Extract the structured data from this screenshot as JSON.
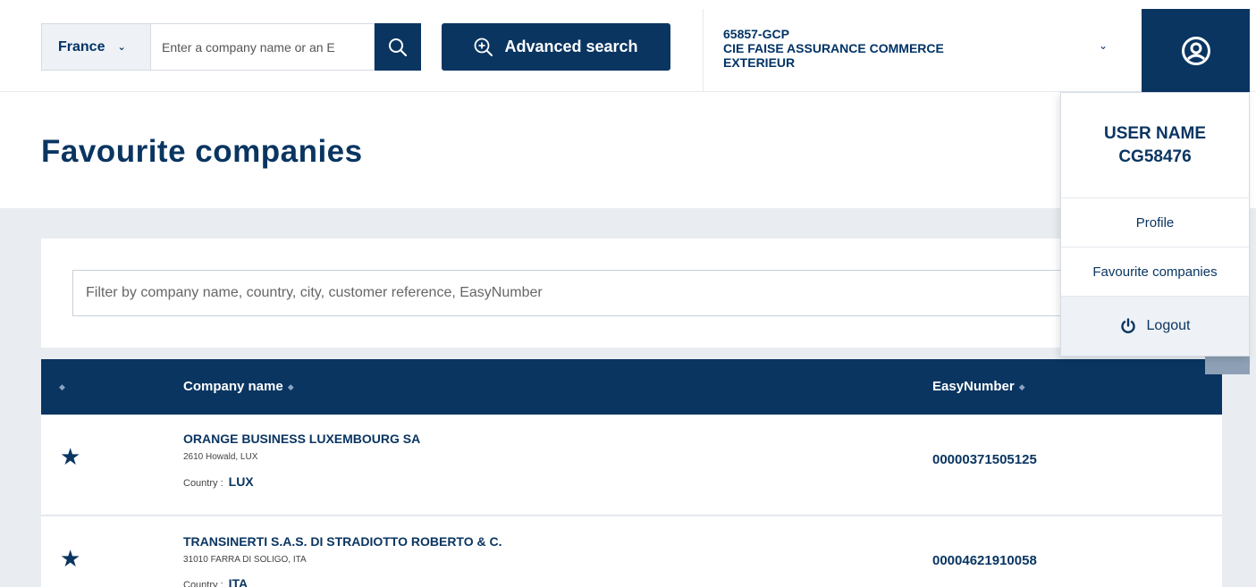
{
  "header": {
    "country": "France",
    "search_placeholder": "Enter a company name or an E",
    "advanced_search_label": "Advanced search",
    "account_line1": "65857-GCP",
    "account_line2": "CIE FAISE ASSURANCE COMMERCE",
    "account_line3": "EXTERIEUR"
  },
  "page": {
    "title": "Favourite companies",
    "filter_placeholder": "Filter by company name, country, city, customer reference, EasyNumber"
  },
  "table": {
    "columns": [
      "Company name",
      "EasyNumber"
    ],
    "rows": [
      {
        "name": "ORANGE BUSINESS LUXEMBOURG SA",
        "address": "2610 Howald, LUX",
        "country_label": "Country :",
        "country": "LUX",
        "easynumber": "00000371505125"
      },
      {
        "name": "TRANSINERTI S.A.S. DI STRADIOTTO ROBERTO & C.",
        "address": "31010 FARRA DI SOLIGO, ITA",
        "country_label": "Country :",
        "country": "ITA",
        "easynumber": "00004621910058"
      }
    ]
  },
  "user_menu": {
    "user_name": "USER NAME",
    "user_id": "CG58476",
    "items": [
      "Profile",
      "Favourite companies"
    ],
    "logout": "Logout"
  },
  "colors": {
    "primary": "#0a3561",
    "grey_bg": "#e9edf1"
  }
}
